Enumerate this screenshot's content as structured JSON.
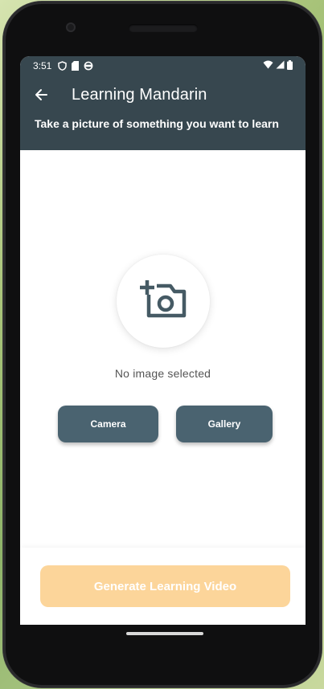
{
  "status_bar": {
    "time": "3:51"
  },
  "app_bar": {
    "title": "Learning Mandarin",
    "subtitle": "Take a picture of something you want to learn"
  },
  "content": {
    "empty_state_text": "No image selected",
    "camera_button": "Camera",
    "gallery_button": "Gallery"
  },
  "footer": {
    "generate_button": "Generate Learning Video"
  },
  "colors": {
    "app_bar": "#37474f",
    "button": "#4a6370",
    "generate_button_disabled": "#fcd59a"
  }
}
